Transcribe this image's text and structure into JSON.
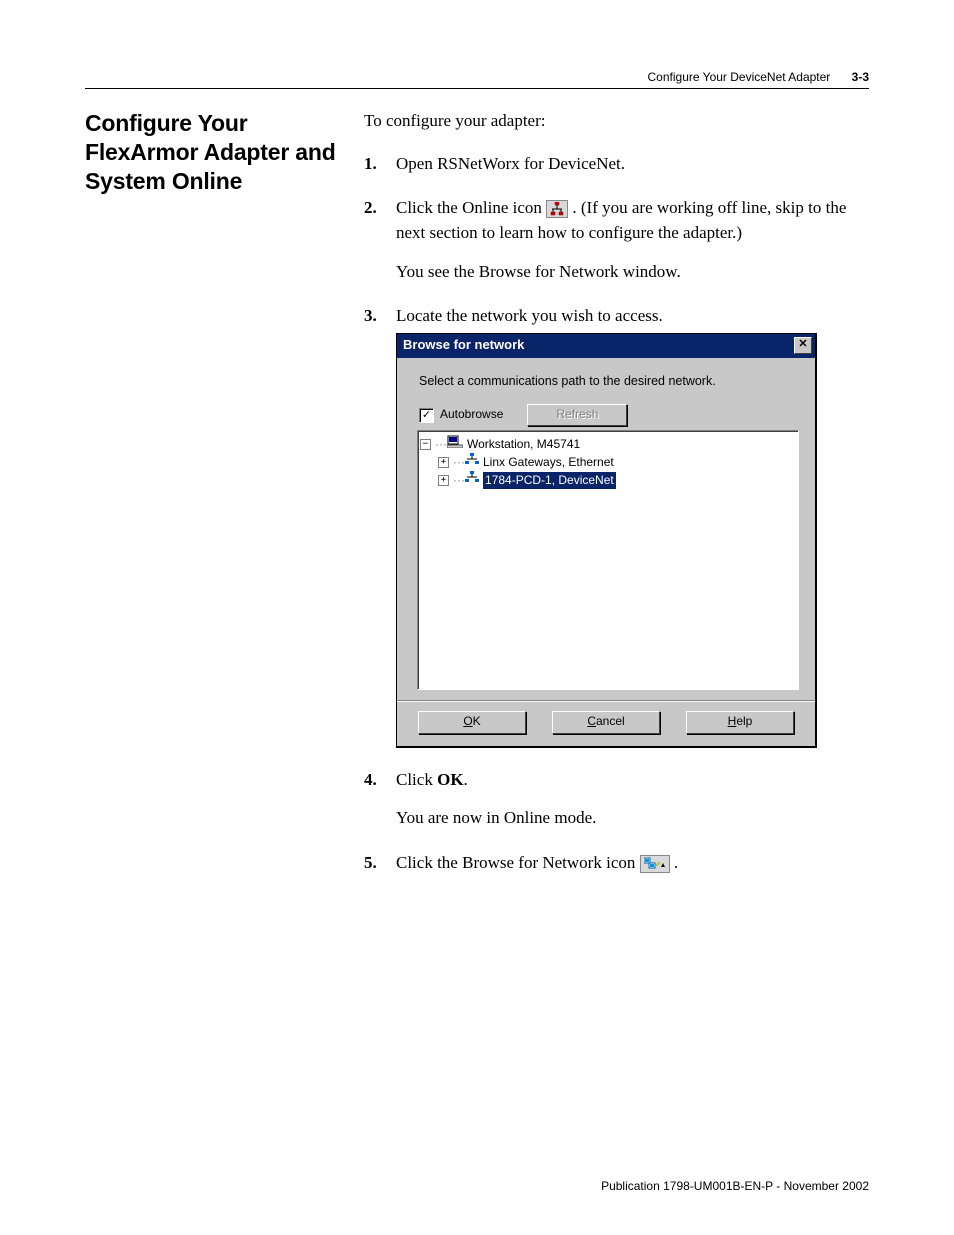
{
  "header": {
    "running_title": "Configure Your DeviceNet Adapter",
    "page_label": "3-3"
  },
  "section": {
    "heading": "Configure Your FlexArmor Adapter and System Online",
    "intro": "To configure your adapter:",
    "steps": {
      "s1": "Open RSNetWorx for DeviceNet.",
      "s2a": "Click the Online icon ",
      "s2b": ". (If you are working off line, skip to the next section to learn how to configure the adapter.)",
      "s2_follow": "You see the Browse for Network window.",
      "s3": "Locate the network you wish to access.",
      "s4a": "Click ",
      "s4b": "OK",
      "s4c": ".",
      "s4_follow": "You are now in Online mode.",
      "s5a": "Click the Browse for Network icon ",
      "s5b": "."
    }
  },
  "dialog": {
    "title": "Browse for network",
    "instruction": "Select a communications path to the desired network.",
    "autobrowse_label": "Autobrowse",
    "autobrowse_checked": "✓",
    "refresh_label": "Refresh",
    "tree": {
      "root": "Workstation, M45741",
      "child1": "Linx Gateways, Ethernet",
      "child2": "1784-PCD-1, DeviceNet"
    },
    "buttons": {
      "ok_u": "O",
      "ok_rest": "K",
      "cancel_u": "C",
      "cancel_rest": "ancel",
      "help_u": "H",
      "help_rest": "elp"
    }
  },
  "footer": {
    "pub": "Publication 1798-UM001B-EN-P - November 2002"
  }
}
